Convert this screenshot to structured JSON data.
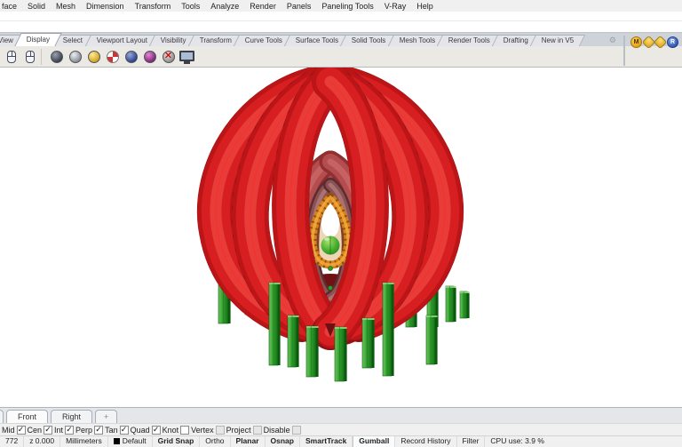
{
  "menu_bar": {
    "items": [
      "face",
      "Solid",
      "Mesh",
      "Dimension",
      "Transform",
      "Tools",
      "Analyze",
      "Render",
      "Panels",
      "Paneling Tools",
      "V-Ray",
      "Help"
    ]
  },
  "command_area": {
    "line1": "",
    "line2": ""
  },
  "ribbon": {
    "tabs": [
      {
        "label": "View",
        "partial": true
      },
      {
        "label": "Display",
        "active": true
      },
      {
        "label": "Select"
      },
      {
        "label": "Viewport Layout"
      },
      {
        "label": "Visibility"
      },
      {
        "label": "Transform"
      },
      {
        "label": "Curve Tools"
      },
      {
        "label": "Surface Tools"
      },
      {
        "label": "Solid Tools"
      },
      {
        "label": "Mesh Tools"
      },
      {
        "label": "Render Tools"
      },
      {
        "label": "Drafting"
      },
      {
        "label": "New in V5"
      }
    ],
    "gear_icon": "gear-icon",
    "toolbar_icons": [
      "mouse-left-icon",
      "mouse-right-icon",
      "separator",
      "wireframe-viewport-icon",
      "shaded-viewport-icon",
      "rendered-viewport-icon",
      "ghosted-viewport-icon",
      "xray-viewport-icon",
      "technical-viewport-icon",
      "hide-display-icon",
      "fullscreen-monitor-icon"
    ],
    "right_icons": [
      {
        "name": "vray-materials-icon",
        "label": "M"
      },
      {
        "name": "vray-toolbar-icon-1",
        "label": ""
      },
      {
        "name": "vray-toolbar-icon-2",
        "label": ""
      },
      {
        "name": "vray-render-icon",
        "label": "R"
      }
    ]
  },
  "viewport": {
    "model_colors": {
      "petal_red": "#bc2227",
      "petal_wire_red": "#ff1a1a",
      "inner_red": "#9a6163",
      "bud_orange": "#d9821a",
      "sphere_green": "#35a32f",
      "leaf_green": "#2f9c2c",
      "background": "#ffffff"
    }
  },
  "viewport_tabs": {
    "tabs": [
      {
        "label": "Front",
        "active": true
      },
      {
        "label": "Right"
      }
    ],
    "new_tab_label": "+"
  },
  "osnap_bar": {
    "items": [
      {
        "label": "Mid",
        "checked": true
      },
      {
        "label": "Cen",
        "checked": true
      },
      {
        "label": "Int",
        "checked": true
      },
      {
        "label": "Perp",
        "checked": true
      },
      {
        "label": "Tan",
        "checked": true
      },
      {
        "label": "Quad",
        "checked": true
      },
      {
        "label": "Knot",
        "checked": false
      },
      {
        "label": "Vertex",
        "checked": false,
        "disabled": true
      },
      {
        "label": "Project",
        "checked": false,
        "disabled": true
      },
      {
        "label": "Disable",
        "checked": false,
        "disabled": true
      }
    ]
  },
  "status_bar": {
    "coordinate_partial": "772",
    "z_coordinate": "z 0.000",
    "units": "Millimeters",
    "layer": "Default",
    "panes": [
      {
        "label": "Grid Snap",
        "bold": true
      },
      {
        "label": "Ortho"
      },
      {
        "label": "Planar",
        "bold": true
      },
      {
        "label": "Osnap",
        "bold": true
      },
      {
        "label": "SmartTrack",
        "bold": true
      },
      {
        "label": "Gumball",
        "bold": true,
        "raised": true
      },
      {
        "label": "Record History"
      },
      {
        "label": "Filter"
      }
    ],
    "cpu": "CPU use: 3.9 %"
  }
}
